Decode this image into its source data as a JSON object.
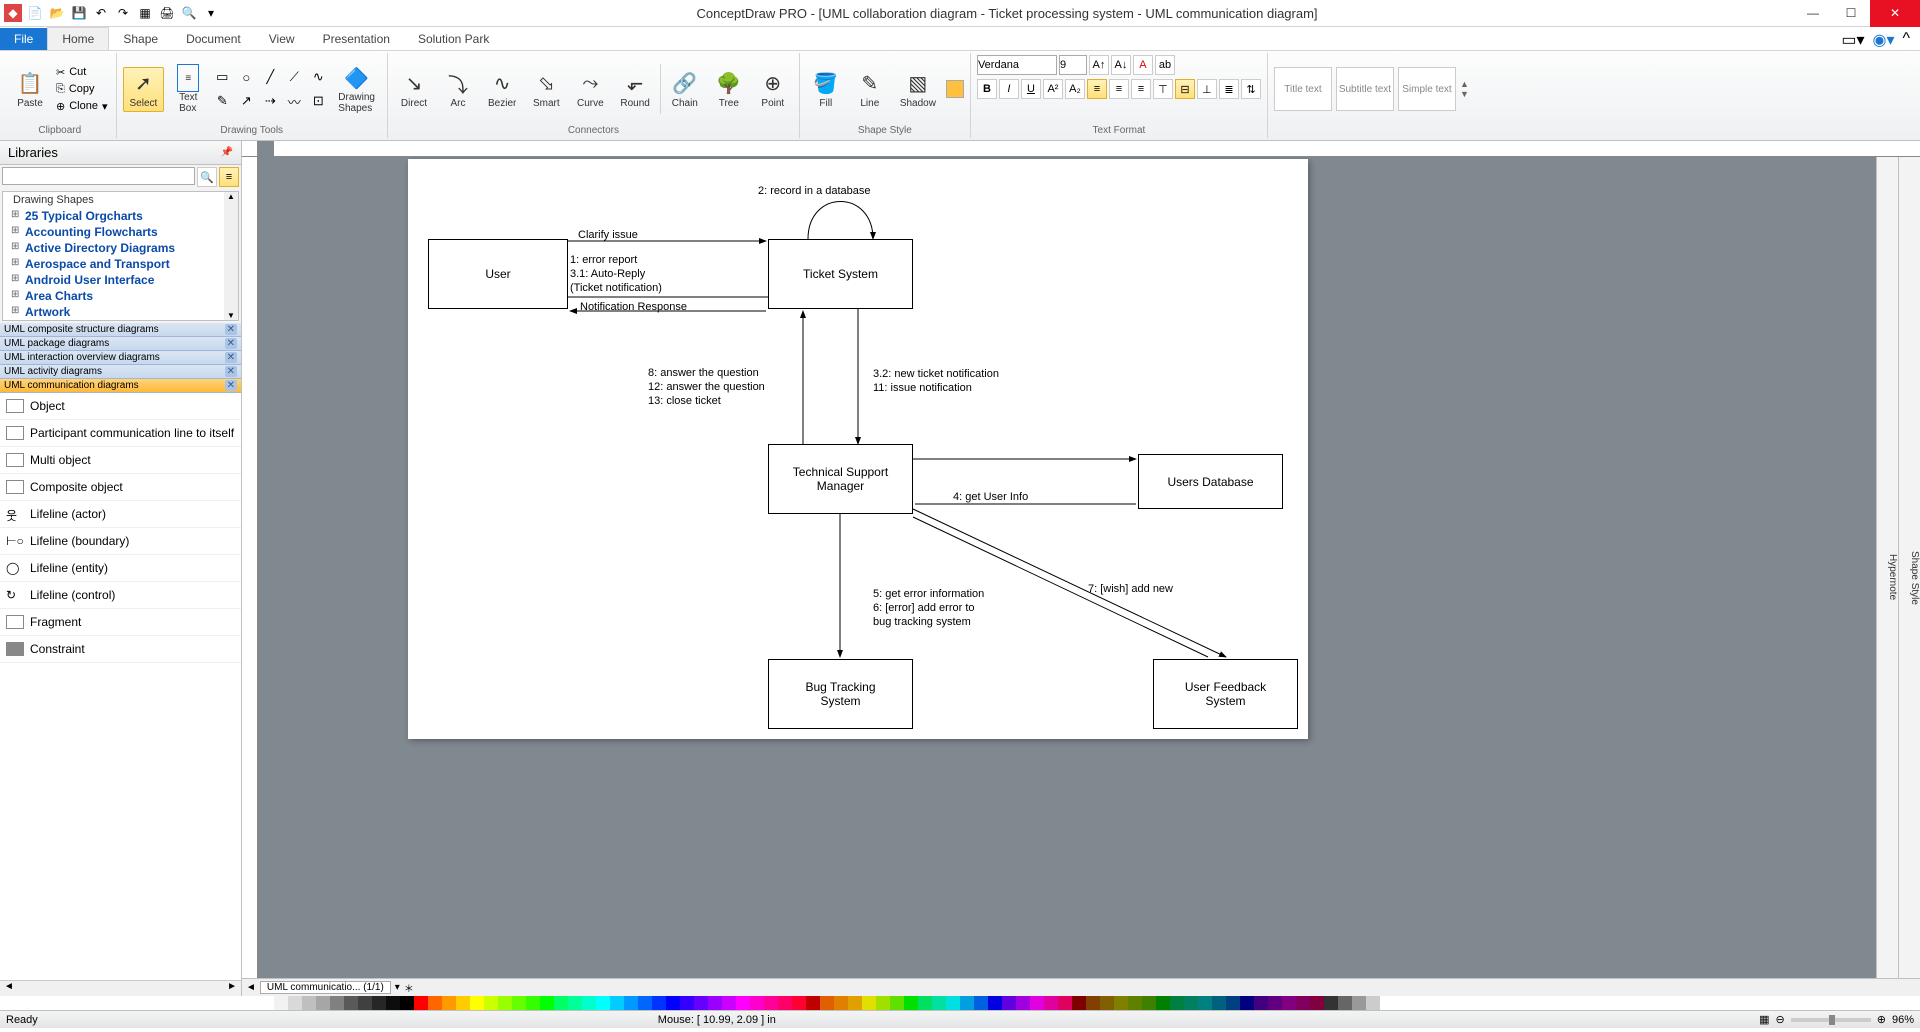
{
  "app": {
    "title": "ConceptDraw PRO - [UML collaboration diagram - Ticket processing system - UML communication diagram]"
  },
  "menu": {
    "file": "File",
    "tabs": [
      "Home",
      "Shape",
      "Document",
      "View",
      "Presentation",
      "Solution Park"
    ],
    "active": "Home"
  },
  "ribbon": {
    "clipboard": {
      "paste": "Paste",
      "cut": "Cut",
      "copy": "Copy",
      "clone": "Clone",
      "label": "Clipboard"
    },
    "select": {
      "select": "Select",
      "textbox": "Text\nBox",
      "label": "Drawing Tools"
    },
    "drawing": {
      "label": "Drawing\nShapes"
    },
    "connectors": {
      "direct": "Direct",
      "arc": "Arc",
      "bezier": "Bezier",
      "smart": "Smart",
      "curve": "Curve",
      "round": "Round",
      "chain": "Chain",
      "tree": "Tree",
      "point": "Point",
      "label": "Connectors"
    },
    "shapestyle": {
      "fill": "Fill",
      "line": "Line",
      "shadow": "Shadow",
      "label": "Shape Style"
    },
    "text": {
      "font": "Verdana",
      "size": "9",
      "label": "Text Format"
    },
    "styles": {
      "title": "Title text",
      "subtitle": "Subtitle text",
      "simple": "Simple text"
    }
  },
  "sidebar": {
    "title": "Libraries",
    "tree_header": "Drawing Shapes",
    "tree": [
      "25 Typical Orgcharts",
      "Accounting Flowcharts",
      "Active Directory Diagrams",
      "Aerospace and Transport",
      "Android User Interface",
      "Area Charts",
      "Artwork"
    ],
    "tabs": [
      "UML composite structure diagrams",
      "UML package diagrams",
      "UML interaction overview diagrams",
      "UML activity diagrams",
      "UML communication diagrams"
    ],
    "active_tab": 4,
    "shapes": [
      "Object",
      "Participant communication line to itself",
      "Multi object",
      "Composite object",
      "Lifeline (actor)",
      "Lifeline (boundary)",
      "Lifeline (entity)",
      "Lifeline (control)",
      "Fragment",
      "Constraint"
    ]
  },
  "diagram": {
    "nodes": {
      "user": "User",
      "ticket": "Ticket System",
      "tsm": "Technical Support\nManager",
      "udb": "Users Database",
      "bug": "Bug Tracking\nSystem",
      "ufs": "User Feedback\nSystem"
    },
    "messages": {
      "m2": "2: record in a database",
      "clarify": "Clarify issue",
      "m1": "1: error report\n3.1: Auto-Reply\n(Ticket notification)",
      "notif": "Notification Response",
      "m32": "3.2: new ticket notification\n11: issue notification",
      "m8": "8: answer the question\n12: answer the question\n13: close ticket",
      "m4": "4: get User Info",
      "m5": "5: get error information\n6: [error] add error to\nbug tracking system",
      "m7": "7: [wish] add new"
    }
  },
  "page_tab": "UML communicatio... (1/1)",
  "status": {
    "ready": "Ready",
    "mouse": "Mouse: [ 10.99, 2.09 ] in",
    "zoom": "96%"
  },
  "right_panes": [
    "Hypernote",
    "Shape Style"
  ],
  "colors": [
    "#ffffff",
    "#f2f2f2",
    "#d9d9d9",
    "#bfbfbf",
    "#a6a6a6",
    "#808080",
    "#595959",
    "#404040",
    "#262626",
    "#0d0d0d",
    "#000000",
    "#ff0000",
    "#ff6600",
    "#ff9900",
    "#ffcc00",
    "#ffff00",
    "#ccff00",
    "#99ff00",
    "#66ff00",
    "#33ff00",
    "#00ff00",
    "#00ff66",
    "#00ff99",
    "#00ffcc",
    "#00ffff",
    "#00ccff",
    "#0099ff",
    "#0066ff",
    "#0033ff",
    "#0000ff",
    "#3300ff",
    "#6600ff",
    "#9900ff",
    "#cc00ff",
    "#ff00ff",
    "#ff00cc",
    "#ff0099",
    "#ff0066",
    "#ff0033",
    "#c00000",
    "#e06000",
    "#e08000",
    "#e0a000",
    "#e0e000",
    "#a0e000",
    "#60e000",
    "#00e000",
    "#00e060",
    "#00e0a0",
    "#00e0e0",
    "#00a0e0",
    "#0060e0",
    "#0000e0",
    "#6000e0",
    "#a000e0",
    "#e000e0",
    "#e000a0",
    "#e00060",
    "#800000",
    "#804000",
    "#806000",
    "#808000",
    "#608000",
    "#408000",
    "#008000",
    "#008040",
    "#008060",
    "#008080",
    "#006080",
    "#004080",
    "#000080",
    "#400080",
    "#600080",
    "#800080",
    "#800060",
    "#800040",
    "#333333",
    "#666666",
    "#999999",
    "#cccccc"
  ]
}
